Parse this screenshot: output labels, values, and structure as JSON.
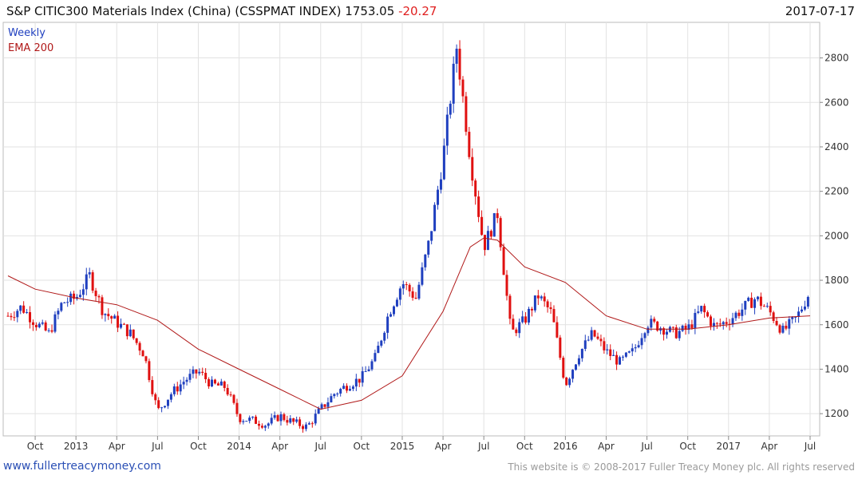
{
  "header": {
    "title": "S&P CITIC300 Materials Index (China) (CSSPMAT INDEX) 1753.05",
    "change": "-20.27",
    "date": "2017-07-17"
  },
  "legend": {
    "weekly_label": "Weekly",
    "ema_label": "EMA 200",
    "weekly_color": "#1f3fbf",
    "ema_color": "#b01818"
  },
  "footer": {
    "site": "www.fullertreacymoney.com",
    "copyright": "This website is © 2008-2017 Fuller Treacy Money plc. All rights reserved"
  },
  "chart_data": {
    "type": "candlestick",
    "y_ticks": [
      1200,
      1400,
      1600,
      1800,
      2000,
      2200,
      2400,
      2600,
      2800
    ],
    "ylim": [
      1100,
      2960
    ],
    "x_ticks": [
      {
        "label": "Oct",
        "date": "2012-10"
      },
      {
        "label": "2013",
        "date": "2013-01"
      },
      {
        "label": "Apr",
        "date": "2013-04"
      },
      {
        "label": "Jul",
        "date": "2013-07"
      },
      {
        "label": "Oct",
        "date": "2013-10"
      },
      {
        "label": "2014",
        "date": "2014-01"
      },
      {
        "label": "Apr",
        "date": "2014-04"
      },
      {
        "label": "Jul",
        "date": "2014-07"
      },
      {
        "label": "Oct",
        "date": "2014-10"
      },
      {
        "label": "2015",
        "date": "2015-01"
      },
      {
        "label": "Apr",
        "date": "2015-04"
      },
      {
        "label": "Jul",
        "date": "2015-07"
      },
      {
        "label": "Oct",
        "date": "2015-10"
      },
      {
        "label": "2016",
        "date": "2016-01"
      },
      {
        "label": "Apr",
        "date": "2016-04"
      },
      {
        "label": "Jul",
        "date": "2016-07"
      },
      {
        "label": "Oct",
        "date": "2016-10"
      },
      {
        "label": "2017",
        "date": "2017-01"
      },
      {
        "label": "Apr",
        "date": "2017-04"
      },
      {
        "label": "Jul",
        "date": "2017-07"
      }
    ],
    "x_range": [
      "2012-08",
      "2017-07"
    ],
    "series": [
      {
        "name": "Weekly",
        "type": "candles",
        "close_points": [
          [
            "2012-08",
            1640
          ],
          [
            "2012-09",
            1680
          ],
          [
            "2012-10",
            1610
          ],
          [
            "2012-11",
            1560
          ],
          [
            "2012-12",
            1700
          ],
          [
            "2013-01",
            1720
          ],
          [
            "2013-02",
            1820
          ],
          [
            "2013-03",
            1660
          ],
          [
            "2013-04",
            1610
          ],
          [
            "2013-05",
            1560
          ],
          [
            "2013-06",
            1470
          ],
          [
            "2013-07",
            1210
          ],
          [
            "2013-08",
            1290
          ],
          [
            "2013-09",
            1350
          ],
          [
            "2013-10",
            1390
          ],
          [
            "2013-11",
            1330
          ],
          [
            "2013-12",
            1320
          ],
          [
            "2014-01",
            1180
          ],
          [
            "2014-02",
            1170
          ],
          [
            "2014-03",
            1150
          ],
          [
            "2014-04",
            1190
          ],
          [
            "2014-05",
            1160
          ],
          [
            "2014-06",
            1140
          ],
          [
            "2014-07",
            1220
          ],
          [
            "2014-08",
            1290
          ],
          [
            "2014-09",
            1330
          ],
          [
            "2014-10",
            1360
          ],
          [
            "2014-11",
            1450
          ],
          [
            "2014-12",
            1650
          ],
          [
            "2015-01",
            1790
          ],
          [
            "2015-02",
            1720
          ],
          [
            "2015-03",
            1980
          ],
          [
            "2015-04",
            2350
          ],
          [
            "2015-05",
            2850
          ],
          [
            "2015-06",
            2350
          ],
          [
            "2015-07",
            1950
          ],
          [
            "2015-08",
            2100
          ],
          [
            "2015-09",
            1560
          ],
          [
            "2015-10",
            1620
          ],
          [
            "2015-11",
            1730
          ],
          [
            "2015-12",
            1650
          ],
          [
            "2016-01",
            1330
          ],
          [
            "2016-02",
            1470
          ],
          [
            "2016-03",
            1560
          ],
          [
            "2016-04",
            1480
          ],
          [
            "2016-05",
            1430
          ],
          [
            "2016-06",
            1480
          ],
          [
            "2016-07",
            1610
          ],
          [
            "2016-08",
            1590
          ],
          [
            "2016-09",
            1560
          ],
          [
            "2016-10",
            1580
          ],
          [
            "2016-11",
            1670
          ],
          [
            "2016-12",
            1590
          ],
          [
            "2017-01",
            1620
          ],
          [
            "2017-02",
            1670
          ],
          [
            "2017-03",
            1720
          ],
          [
            "2017-04",
            1660
          ],
          [
            "2017-05",
            1570
          ],
          [
            "2017-06",
            1630
          ],
          [
            "2017-07",
            1753
          ]
        ]
      },
      {
        "name": "EMA 200",
        "type": "line",
        "points": [
          [
            "2012-08",
            1820
          ],
          [
            "2012-10",
            1760
          ],
          [
            "2013-01",
            1720
          ],
          [
            "2013-04",
            1690
          ],
          [
            "2013-07",
            1620
          ],
          [
            "2013-10",
            1490
          ],
          [
            "2014-01",
            1400
          ],
          [
            "2014-04",
            1310
          ],
          [
            "2014-07",
            1220
          ],
          [
            "2014-10",
            1260
          ],
          [
            "2015-01",
            1370
          ],
          [
            "2015-04",
            1660
          ],
          [
            "2015-06",
            1950
          ],
          [
            "2015-07",
            1990
          ],
          [
            "2015-08",
            1980
          ],
          [
            "2015-10",
            1860
          ],
          [
            "2016-01",
            1790
          ],
          [
            "2016-04",
            1640
          ],
          [
            "2016-07",
            1580
          ],
          [
            "2016-10",
            1580
          ],
          [
            "2017-01",
            1600
          ],
          [
            "2017-04",
            1630
          ],
          [
            "2017-07",
            1640
          ]
        ]
      }
    ]
  }
}
